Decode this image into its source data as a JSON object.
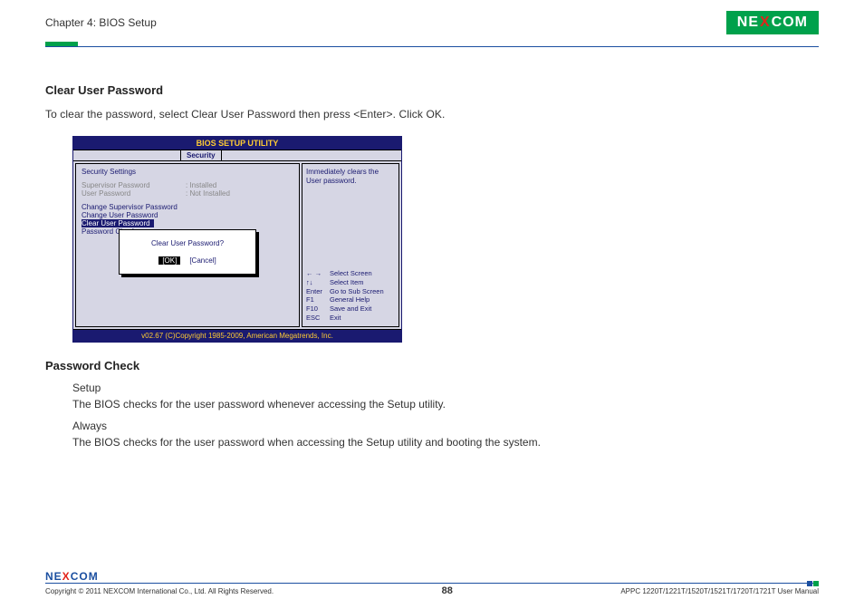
{
  "header": {
    "chapter": "Chapter 4: BIOS Setup",
    "brand_pre": "NE",
    "brand_x": "X",
    "brand_post": "COM"
  },
  "sections": {
    "clear_user_password": {
      "heading": "Clear User Password",
      "description": "To clear the password, select Clear User Password then press <Enter>. Click OK."
    },
    "password_check": {
      "heading": "Password Check",
      "setup_label": "Setup",
      "setup_desc": "The BIOS checks for the user password whenever accessing the Setup utility.",
      "always_label": "Always",
      "always_desc": "The BIOS checks for the user password when accessing the Setup utility and booting the system."
    }
  },
  "bios": {
    "title": "BIOS SETUP UTILITY",
    "tab": "Security",
    "left": {
      "section_label": "Security Settings",
      "supervisor_label": "Supervisor Password",
      "supervisor_value": ": Installed",
      "user_label": "User Password",
      "user_value": ": Not Installed",
      "change_supervisor": "Change Supervisor Password",
      "change_user": "Change User Password",
      "clear_user": "Clear User Password",
      "password_check": "Password Check"
    },
    "right": {
      "help_text": "Immediately clears the User password.",
      "nav": {
        "arrows_lr": "←  →",
        "arrows_lr_desc": "Select Screen",
        "arrows_ud": "↑↓",
        "arrows_ud_desc": "Select Item",
        "enter": "Enter",
        "enter_desc": "Go to Sub Screen",
        "f1": "F1",
        "f1_desc": "General Help",
        "f10": "F10",
        "f10_desc": "Save and Exit",
        "esc": "ESC",
        "esc_desc": "Exit"
      }
    },
    "dialog": {
      "question": "Clear User Password?",
      "ok": "[OK]",
      "cancel": "[Cancel]"
    },
    "footer": "v02.67 (C)Copyright 1985-2009, American Megatrends, Inc."
  },
  "footer": {
    "brand_pre": "NE",
    "brand_x": "X",
    "brand_post": "COM",
    "copyright": "Copyright © 2011 NEXCOM International Co., Ltd. All Rights Reserved.",
    "page_number": "88",
    "manual_ref": "APPC 1220T/1221T/1520T/1521T/1720T/1721T User Manual"
  }
}
